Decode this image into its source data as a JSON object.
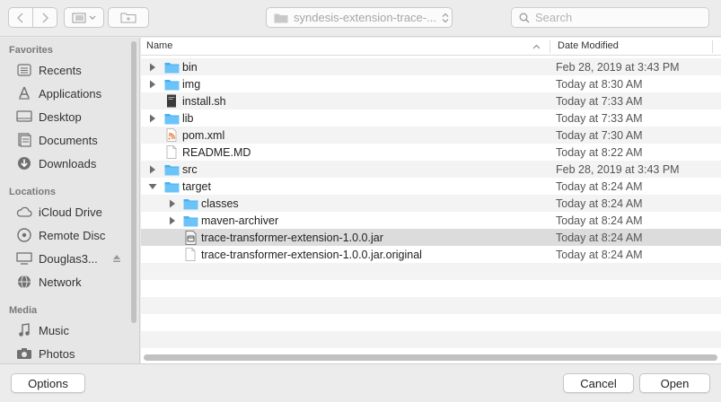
{
  "toolbar": {
    "path_label": "syndesis-extension-trace-...",
    "search_placeholder": "Search"
  },
  "sidebar": {
    "favorites_heading": "Favorites",
    "favorites": [
      {
        "label": "Recents",
        "icon": "recents-icon"
      },
      {
        "label": "Applications",
        "icon": "applications-icon"
      },
      {
        "label": "Desktop",
        "icon": "desktop-icon"
      },
      {
        "label": "Documents",
        "icon": "documents-icon"
      },
      {
        "label": "Downloads",
        "icon": "downloads-icon"
      }
    ],
    "locations_heading": "Locations",
    "locations": [
      {
        "label": "iCloud Drive",
        "icon": "icloud-icon"
      },
      {
        "label": "Remote Disc",
        "icon": "disc-icon"
      },
      {
        "label": "Douglas3...",
        "icon": "computer-icon"
      },
      {
        "label": "Network",
        "icon": "network-icon"
      }
    ],
    "media_heading": "Media",
    "media": [
      {
        "label": "Music",
        "icon": "music-icon"
      },
      {
        "label": "Photos",
        "icon": "camera-icon"
      }
    ]
  },
  "columns": {
    "name": "Name",
    "date": "Date Modified"
  },
  "files": [
    {
      "name": "bin",
      "date": "Feb 28, 2019 at 3:43 PM",
      "type": "folder",
      "expanded": false
    },
    {
      "name": "img",
      "date": "Today at 8:30 AM",
      "type": "folder",
      "expanded": false
    },
    {
      "name": "install.sh",
      "date": "Today at 7:33 AM",
      "type": "script"
    },
    {
      "name": "lib",
      "date": "Today at 7:33 AM",
      "type": "folder",
      "expanded": false
    },
    {
      "name": "pom.xml",
      "date": "Today at 7:30 AM",
      "type": "xml"
    },
    {
      "name": "README.MD",
      "date": "Today at 8:22 AM",
      "type": "document"
    },
    {
      "name": "src",
      "date": "Feb 28, 2019 at 3:43 PM",
      "type": "folder",
      "expanded": false
    },
    {
      "name": "target",
      "date": "Today at 8:24 AM",
      "type": "folder",
      "expanded": true
    },
    {
      "name": "classes",
      "date": "Today at 8:24 AM",
      "type": "folder",
      "expanded": false
    },
    {
      "name": "maven-archiver",
      "date": "Today at 8:24 AM",
      "type": "folder",
      "expanded": false
    },
    {
      "name": "trace-transformer-extension-1.0.0.jar",
      "date": "Today at 8:24 AM",
      "type": "jar",
      "selected": true
    },
    {
      "name": "trace-transformer-extension-1.0.0.jar.original",
      "date": "Today at 8:24 AM",
      "type": "document"
    }
  ],
  "buttons": {
    "options": "Options",
    "cancel": "Cancel",
    "open": "Open"
  }
}
